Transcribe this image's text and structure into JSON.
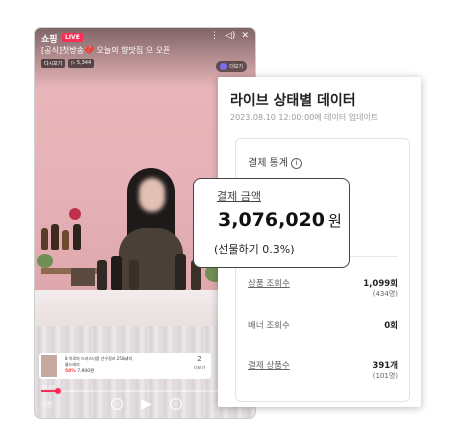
{
  "live": {
    "brand": "쇼핑",
    "badge": "LIVE",
    "title": "[공식]첫방송💔 오늘의 향맛집        으 오픈",
    "chips": [
      "다시보기",
      "▷ 5,344"
    ],
    "follow_label": "더보기",
    "product": {
      "name": "8 아로마 드러스더품 선우정라 250㎖의",
      "name2": "룸드레리",
      "discount": "50%",
      "price": "7,900원",
      "count": "2",
      "count_label": "더보기"
    },
    "timecode": "00:09",
    "progress": 0.08,
    "speed": "1×"
  },
  "panel": {
    "title": "라이브 상태별 데이터",
    "updated": "2023.08.10 12:00:00에 데이터 업데이트",
    "section_label": "결제 통계",
    "metrics": [
      {
        "label": "상품 조회수",
        "value": "1,099회",
        "sub": "(434명)",
        "link": true
      },
      {
        "label": "배너 조회수",
        "value": "0회",
        "sub": "",
        "link": false
      },
      {
        "label": "결제 상품수",
        "value": "391개",
        "sub": "(101명)",
        "link": true
      }
    ]
  },
  "callout": {
    "label": "결제 금액",
    "value": "3,076,020",
    "unit": "원",
    "note": "(선물하기 0.3%)"
  },
  "colors": {
    "live_red": "#ff2d55",
    "wall_pink": "#e6b2b7",
    "panel_border": "#e3e3e3"
  }
}
